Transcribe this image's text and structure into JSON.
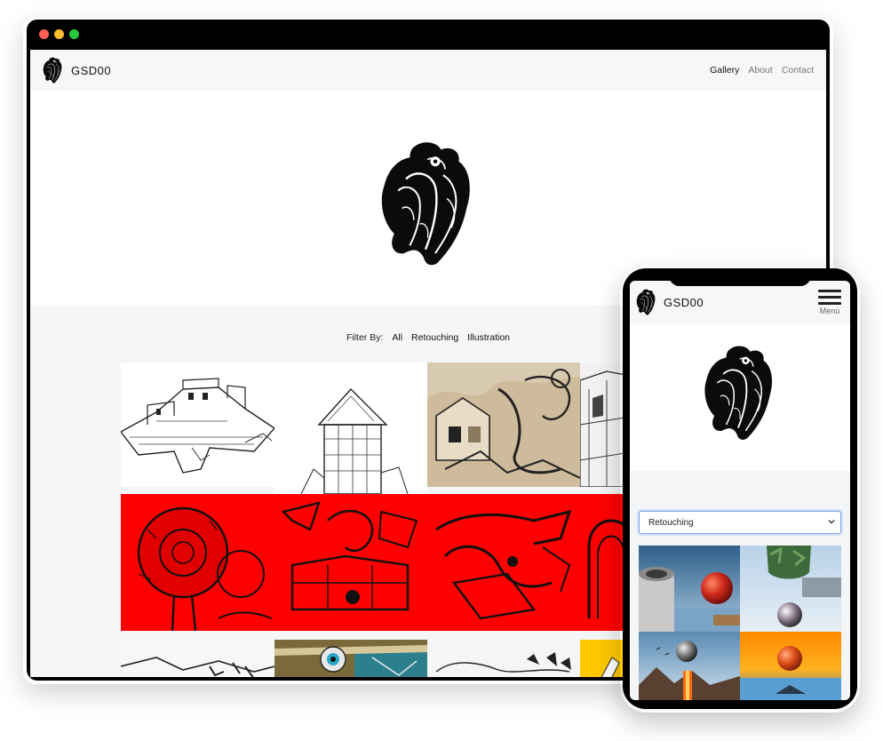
{
  "desktop": {
    "window_dots": [
      "#ff5f57",
      "#febc2e",
      "#28c840"
    ],
    "brand": {
      "name": "GSD00",
      "logo_icon": "anatomical-heart-logo"
    },
    "nav": [
      {
        "label": "Gallery",
        "active": true
      },
      {
        "label": "About",
        "active": false
      },
      {
        "label": "Contact",
        "active": false
      }
    ],
    "hero_icon": "anatomical-heart-logo",
    "filter": {
      "label": "Filter By:",
      "options": [
        "All",
        "Retouching",
        "Illustration"
      ]
    },
    "gallery_items": [
      "castle-sketch",
      "tower-sketch",
      "surreal-sepia-drawing",
      "street-sketch",
      "red-tree-illustration",
      "red-house-illustration",
      "red-hand-illustration",
      "red-arch-illustration",
      "ink-ruins-sketch",
      "eye-collage",
      "ink-fragments-sketch",
      "yellow-figure"
    ]
  },
  "mobile": {
    "brand": {
      "name": "GSD00",
      "logo_icon": "anatomical-heart-logo"
    },
    "menu_label": "Menú",
    "menu_icon": "hamburger-icon",
    "hero_icon": "anatomical-heart-logo",
    "filter_select": {
      "selected": "Retouching"
    },
    "gallery_items": [
      "pipes-red-sphere",
      "plant-silver-sphere",
      "grey-sphere-fire",
      "orange-sunset-sphere"
    ]
  },
  "colors": {
    "accent_red": "#ff0000",
    "select_border": "#7aa7e8",
    "page_bg": "#f5f6f8"
  }
}
